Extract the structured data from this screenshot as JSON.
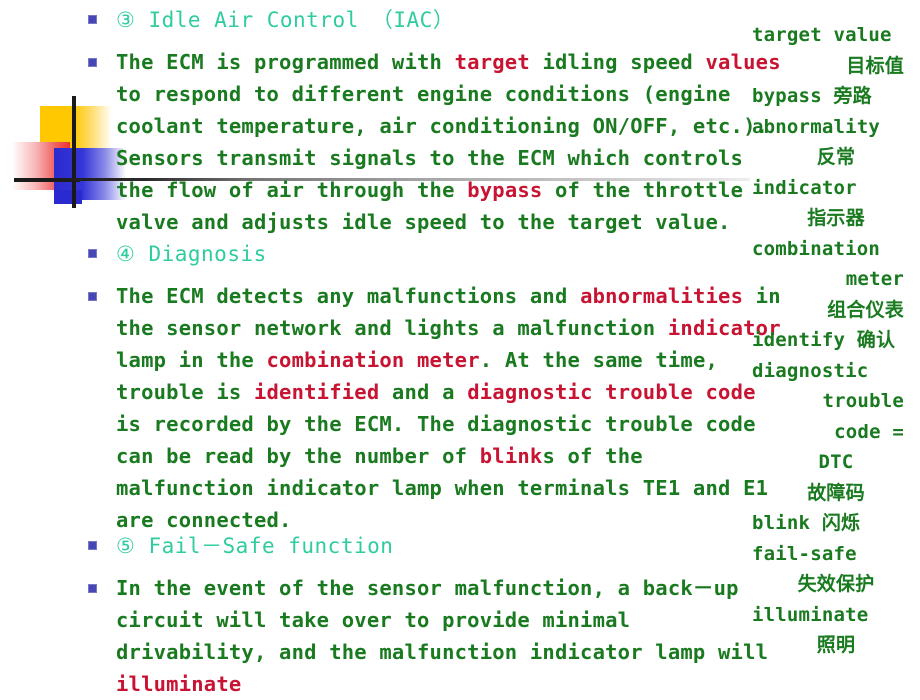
{
  "colors": {
    "body_text": "#1A7A20",
    "heading_text": "#2FCCA0",
    "highlight_text": "#C81432",
    "bullet": "#4646B4",
    "deco_yellow": "#FFC800",
    "deco_red": "#F03030",
    "deco_blue": "#2A2ACF",
    "rule": "#1A1A1A"
  },
  "slide": {
    "blocks": [
      {
        "type": "heading",
        "name": "heading-idle-air-control",
        "runs": [
          {
            "text": "③ Idle Air Control （IAC）",
            "hl": false
          }
        ]
      },
      {
        "type": "paragraph",
        "name": "paragraph-idle-air-control",
        "runs": [
          {
            "text": "The ECM is programmed with ",
            "hl": false
          },
          {
            "text": "target",
            "hl": true
          },
          {
            "text": " idling speed ",
            "hl": false
          },
          {
            "text": "values",
            "hl": true
          },
          {
            "text": "\nto respond to different engine conditions (engine\ncoolant temperature, air conditioning ON/OFF, etc.).\nSensors transmit signals to the ECM which controls\nthe flow of air through the ",
            "hl": false
          },
          {
            "text": "bypass",
            "hl": true
          },
          {
            "text": " of the throttle\nvalve and adjusts idle speed to the target value.",
            "hl": false
          }
        ]
      },
      {
        "type": "heading",
        "name": "heading-diagnosis",
        "runs": [
          {
            "text": "④ Diagnosis",
            "hl": false
          }
        ]
      },
      {
        "type": "paragraph",
        "name": "paragraph-diagnosis",
        "runs": [
          {
            "text": "The ECM detects any malfunctions and ",
            "hl": false
          },
          {
            "text": "abnormalities",
            "hl": true
          },
          {
            "text": " in\nthe sensor network and lights a malfunction ",
            "hl": false
          },
          {
            "text": "indicator",
            "hl": true
          },
          {
            "text": "\nlamp in the ",
            "hl": false
          },
          {
            "text": "combination meter",
            "hl": true
          },
          {
            "text": ". At the same time,\ntrouble is ",
            "hl": false
          },
          {
            "text": "identified",
            "hl": true
          },
          {
            "text": " and a ",
            "hl": false
          },
          {
            "text": "diagnostic trouble code",
            "hl": true
          },
          {
            "text": "\nis recorded by the ECM. The diagnostic trouble code\ncan be read by the number of ",
            "hl": false
          },
          {
            "text": "blink",
            "hl": true
          },
          {
            "text": "s of the\nmalfunction indicator lamp when terminals TE1 and E1\nare connected.",
            "hl": false
          }
        ]
      },
      {
        "type": "heading",
        "name": "heading-fail-safe-function",
        "runs": [
          {
            "text": "⑤ Fail－Safe function",
            "hl": false
          }
        ]
      },
      {
        "type": "paragraph",
        "name": "paragraph-fail-safe-function",
        "runs": [
          {
            "text": "In the event of the sensor malfunction, a back－up\ncircuit will take over to provide minimal\ndrivability, and the malfunction indicator lamp will\n",
            "hl": false
          },
          {
            "text": "illuminate",
            "hl": true
          }
        ]
      }
    ]
  },
  "vocabulary": {
    "name": "vocabulary-sidebar",
    "lines": [
      {
        "text": "target value",
        "align": "left"
      },
      {
        "text": "目标值",
        "align": "right"
      },
      {
        "text": "bypass 旁路",
        "align": "left"
      },
      {
        "text": "abnormality",
        "align": "left"
      },
      {
        "text": "反常",
        "align": "center"
      },
      {
        "text": "indicator",
        "align": "left"
      },
      {
        "text": "指示器",
        "align": "center"
      },
      {
        "text": "combination",
        "align": "left"
      },
      {
        "text": "meter",
        "align": "right"
      },
      {
        "text": "组合仪表",
        "align": "right"
      },
      {
        "text": "identify 确认",
        "align": "left"
      },
      {
        "text": "diagnostic",
        "align": "left"
      },
      {
        "text": "trouble",
        "align": "right"
      },
      {
        "text": "code =",
        "align": "right"
      },
      {
        "text": "DTC",
        "align": "center"
      },
      {
        "text": "故障码",
        "align": "center"
      },
      {
        "text": "blink 闪烁",
        "align": "left"
      },
      {
        "text": "fail-safe",
        "align": "left"
      },
      {
        "text": "失效保护",
        "align": "center"
      },
      {
        "text": "illuminate",
        "align": "left"
      },
      {
        "text": "照明",
        "align": "center"
      }
    ]
  }
}
